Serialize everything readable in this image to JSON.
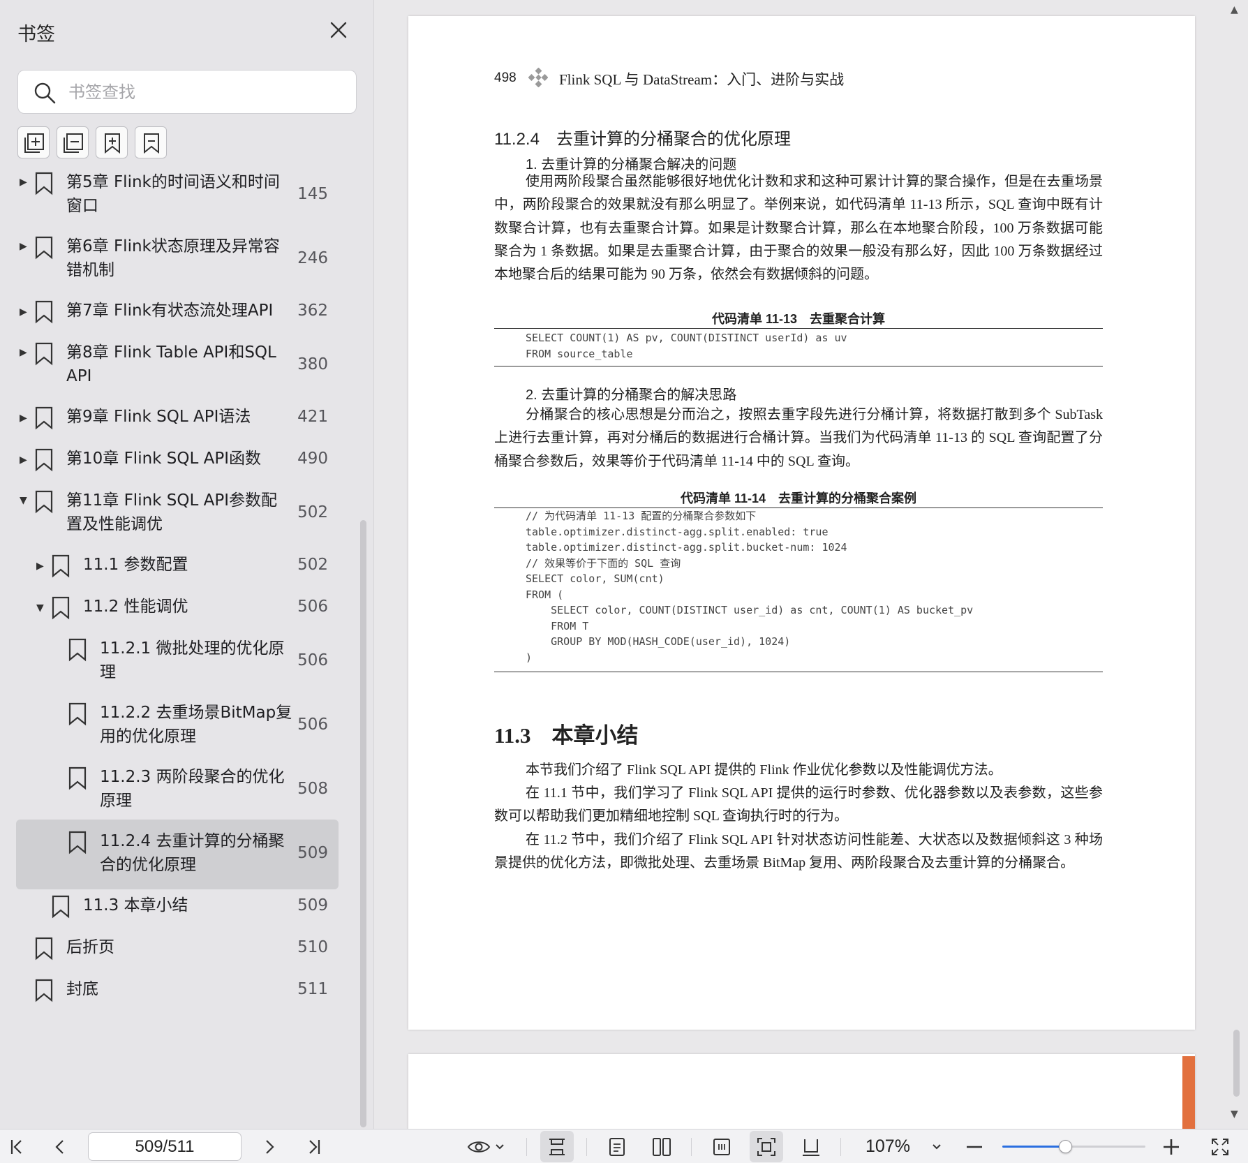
{
  "sidebar": {
    "title": "书签",
    "search_placeholder": "书签查找",
    "tools": [
      "expand-all-icon",
      "collapse-all-icon",
      "add-bookmark-icon",
      "remove-bookmark-icon"
    ],
    "items": [
      {
        "level": 0,
        "toggle": "collapsed",
        "lines": [
          "第5章 Flink的时间语义和时间",
          "窗口"
        ],
        "page": "145"
      },
      {
        "level": 0,
        "toggle": "collapsed",
        "lines": [
          "第6章 Flink状态原理及异常容",
          "错机制"
        ],
        "page": "246"
      },
      {
        "level": 0,
        "toggle": "collapsed",
        "lines": [
          "第7章 Flink有状态流处理API"
        ],
        "page": "362"
      },
      {
        "level": 0,
        "toggle": "collapsed",
        "lines": [
          "第8章 Flink Table API和SQL",
          "API"
        ],
        "page": "380"
      },
      {
        "level": 0,
        "toggle": "collapsed",
        "lines": [
          "第9章 Flink SQL API语法"
        ],
        "page": "421"
      },
      {
        "level": 0,
        "toggle": "collapsed",
        "lines": [
          "第10章 Flink SQL API函数"
        ],
        "page": "490"
      },
      {
        "level": 0,
        "toggle": "expanded",
        "lines": [
          "第11章 Flink SQL API参数配",
          "置及性能调优"
        ],
        "page": "502"
      },
      {
        "level": 1,
        "toggle": "collapsed",
        "lines": [
          "11.1 参数配置"
        ],
        "page": "502"
      },
      {
        "level": 1,
        "toggle": "expanded",
        "lines": [
          "11.2 性能调优"
        ],
        "page": "506"
      },
      {
        "level": 2,
        "toggle": "none",
        "lines": [
          "11.2.1 微批处理的优化原",
          "理"
        ],
        "page": "506"
      },
      {
        "level": 2,
        "toggle": "none",
        "lines": [
          "11.2.2 去重场景BitMap复",
          "用的优化原理"
        ],
        "page": "506"
      },
      {
        "level": 2,
        "toggle": "none",
        "lines": [
          "11.2.3 两阶段聚合的优化",
          "原理"
        ],
        "page": "508"
      },
      {
        "level": 2,
        "toggle": "none",
        "selected": true,
        "lines": [
          "11.2.4 去重计算的分桶聚",
          "合的优化原理"
        ],
        "page": "509"
      },
      {
        "level": 1,
        "toggle": "none",
        "lines": [
          "11.3 本章小结"
        ],
        "page": "509"
      },
      {
        "level": 0,
        "toggle": "none",
        "lines": [
          "后折页"
        ],
        "page": "510"
      },
      {
        "level": 0,
        "toggle": "none",
        "lines": [
          "封底"
        ],
        "page": "511"
      }
    ]
  },
  "page": {
    "header_number": "498",
    "header_title": "Flink SQL 与 DataStream：入门、进阶与实战",
    "section_heading": "11.2.4　去重计算的分桶聚合的优化原理",
    "sub1": "1. 去重计算的分桶聚合解决的问题",
    "para1": "使用两阶段聚合虽然能够很好地优化计数和求和这种可累计计算的聚合操作，但是在去重场景中，两阶段聚合的效果就没有那么明显了。举例来说，如代码清单 11-13 所示，SQL 查询中既有计数聚合计算，也有去重聚合计算。如果是计数聚合计算，那么在本地聚合阶段，100 万条数据可能聚合为 1 条数据。如果是去重聚合计算，由于聚合的效果一般没有那么好，因此 100 万条数据经过本地聚合后的结果可能为 90 万条，依然会有数据倾斜的问题。",
    "caption1": "代码清单 11-13　去重聚合计算",
    "code1": "SELECT COUNT(1) AS pv, COUNT(DISTINCT userId) as uv\nFROM source_table",
    "sub2": "2. 去重计算的分桶聚合的解决思路",
    "para2": "分桶聚合的核心思想是分而治之，按照去重字段先进行分桶计算，将数据打散到多个 SubTask 上进行去重计算，再对分桶后的数据进行合桶计算。当我们为代码清单 11-13 的 SQL 查询配置了分桶聚合参数后，效果等价于代码清单 11-14 中的 SQL 查询。",
    "caption2": "代码清单 11-14　去重计算的分桶聚合案例",
    "code2": "// 为代码清单 11-13 配置的分桶聚合参数如下\ntable.optimizer.distinct-agg.split.enabled: true\ntable.optimizer.distinct-agg.split.bucket-num: 1024\n// 效果等价于下面的 SQL 查询\nSELECT color, SUM(cnt)\nFROM (\n    SELECT color, COUNT(DISTINCT user_id) as cnt, COUNT(1) AS bucket_pv\n    FROM T\n    GROUP BY MOD(HASH_CODE(user_id), 1024)\n)",
    "h2_num": "11.3",
    "h2_title": "本章小结",
    "para3": "本节我们介绍了 Flink SQL API 提供的 Flink 作业优化参数以及性能调优方法。",
    "para4": "在 11.1 节中，我们学习了 Flink SQL API 提供的运行时参数、优化器参数以及表参数，这些参数可以帮助我们更加精细地控制 SQL 查询执行时的行为。",
    "para5": "在 11.2 节中，我们介绍了 Flink SQL API 针对状态访问性能差、大状态以及数据倾斜这 3 种场景提供的优化方法，即微批处理、去重场景 BitMap 复用、两阶段聚合及去重计算的分桶聚合。"
  },
  "toolbar": {
    "page_value": "509/511",
    "zoom_label": "107%",
    "zoom_fraction": 0.44,
    "accent": "#2b6fe0",
    "icons": [
      "first-page-icon",
      "prev-page-icon",
      "next-page-icon",
      "last-page-icon",
      "eye-icon",
      "chevron-down-icon",
      "continuous-scroll-icon",
      "single-page-icon",
      "two-page-icon",
      "fit-width-icon",
      "fit-page-icon",
      "rotate-icon",
      "zoom-out-icon",
      "zoom-in-icon",
      "fullscreen-icon"
    ]
  }
}
